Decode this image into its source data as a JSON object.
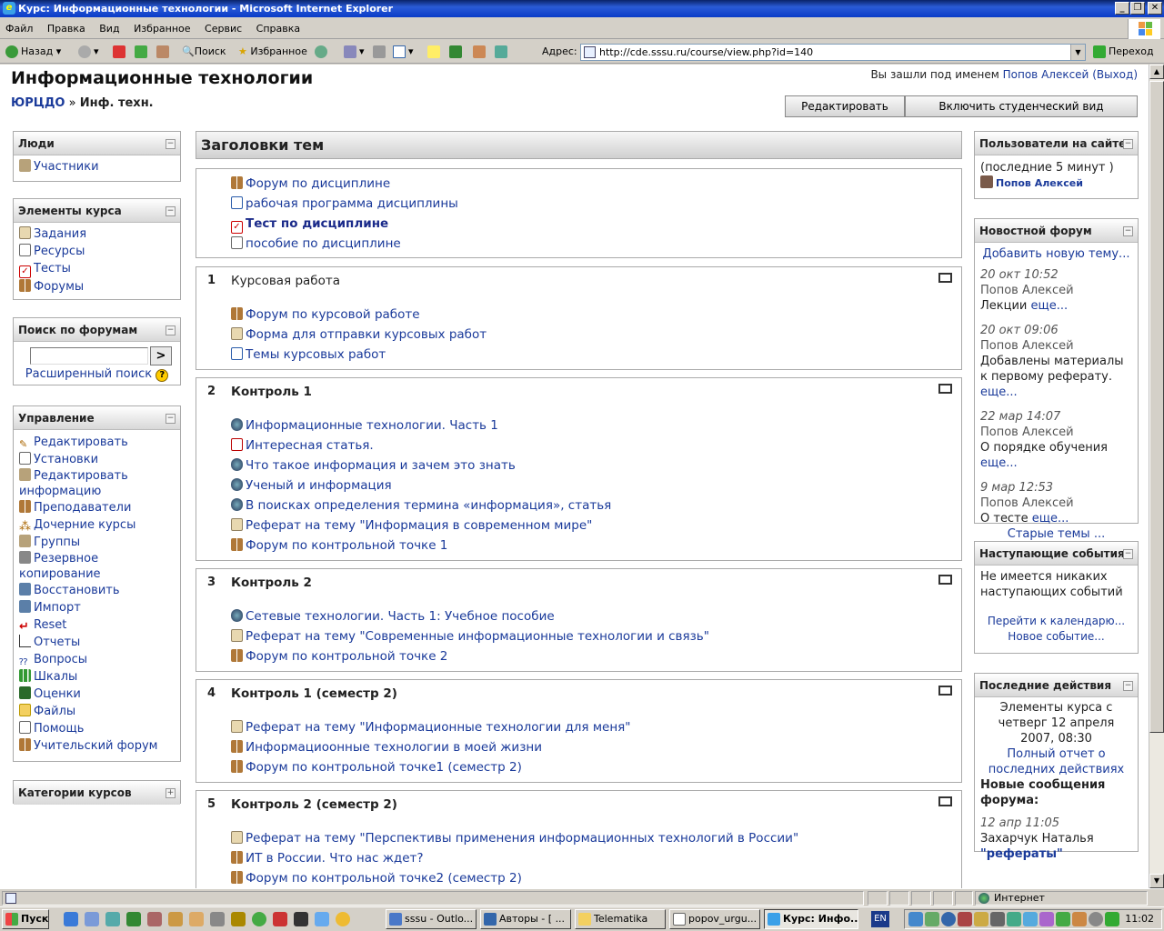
{
  "window": {
    "title": "Курс: Информационные технологии - Microsoft Internet Explorer"
  },
  "menu": [
    "Файл",
    "Правка",
    "Вид",
    "Избранное",
    "Сервис",
    "Справка"
  ],
  "toolbar": {
    "back": "Назад",
    "search": "Поиск",
    "favorites": "Избранное",
    "address_label": "Адрес:",
    "address": "http://cde.sssu.ru/course/view.php?id=140",
    "go": "Переход"
  },
  "header": {
    "title": "Информационные технологии",
    "login_prefix": "Вы зашли под именем",
    "login_user": "Попов Алексей",
    "logout": "(Выход)",
    "breadcrumb_root": "ЮРЦДО",
    "breadcrumb_sep": "»",
    "breadcrumb_current": "Инф. техн.",
    "edit_button": "Редактировать",
    "student_view_button": "Включить студенческий вид"
  },
  "left": {
    "people": {
      "title": "Люди",
      "items": [
        "Участники"
      ]
    },
    "elements": {
      "title": "Элементы курса",
      "items": [
        "Задания",
        "Ресурсы",
        "Тесты",
        "Форумы"
      ]
    },
    "forum_search": {
      "title": "Поиск по форумам",
      "go": ">",
      "advanced": "Расширенный поиск"
    },
    "admin": {
      "title": "Управление",
      "items": [
        "Редактировать",
        "Установки",
        "Редактировать информацию",
        "Преподаватели",
        "Дочерние курсы",
        "Группы",
        "Резервное копирование",
        "Восстановить",
        "Импорт",
        "Reset",
        "Отчеты",
        "Вопросы",
        "Шкалы",
        "Оценки",
        "Файлы",
        "Помощь",
        "Учительский форум"
      ]
    },
    "categories": {
      "title": "Категории курсов"
    }
  },
  "center": {
    "heading": "Заголовки тем",
    "section0": [
      "Форум по дисциплине",
      "рабочая программа дисциплины",
      "Тест по дисциплине",
      "пособие по дисциплине"
    ],
    "sections": [
      {
        "num": "1",
        "title": "Курсовая работа",
        "items": [
          "Форум по курсовой работе",
          "Форма для отправки курсовых работ",
          "Темы курсовых работ"
        ]
      },
      {
        "num": "2",
        "title": "Контроль 1",
        "items": [
          "Информационные технологии. Часть 1",
          "Интересная статья.",
          "Что такое информация и зачем это знать",
          "Ученый и информация",
          "В поисках определения термина «информация», статья",
          "Реферат на тему \"Информация в современном мире\"",
          "Форум по контрольной точке 1"
        ]
      },
      {
        "num": "3",
        "title": "Контроль 2",
        "items": [
          "Сетевые технологии. Часть 1: Учебное пособие",
          "Реферат на тему \"Современные информационные технологии и связь\"",
          "Форум по контрольной точке 2"
        ]
      },
      {
        "num": "4",
        "title": "Контроль 1 (семестр 2)",
        "items": [
          "Реферат на тему \"Информационные технологии для меня\"",
          "Информациоонные технологии в моей жизни",
          "Форум по контрольной точке1 (семестр 2)"
        ]
      },
      {
        "num": "5",
        "title": "Контроль 2 (семестр 2)",
        "items": [
          "Реферат на тему \"Перспективы применения информационных технологий в России\"",
          "ИТ в России. Что нас ждет?",
          "Форум по контрольной точке2 (семестр 2)"
        ]
      }
    ]
  },
  "right": {
    "online": {
      "title": "Пользователи на сайте",
      "period": "(последние 5 минут )",
      "user": "Попов Алексей"
    },
    "news": {
      "title": "Новостной форум",
      "add": "Добавить новую тему...",
      "posts": [
        {
          "date": "20 окт 10:52",
          "author": "Попов Алексей",
          "text": "Лекции",
          "more": "еще..."
        },
        {
          "date": "20 окт 09:06",
          "author": "Попов Алексей",
          "text": "Добавлены материалы к первому реферату.",
          "more": "еще..."
        },
        {
          "date": "22 мар 14:07",
          "author": "Попов Алексей",
          "text": "О порядке обучения",
          "more": "еще..."
        },
        {
          "date": "9 мар 12:53",
          "author": "Попов Алексей",
          "text": "О тесте",
          "more": "еще..."
        }
      ],
      "old": "Старые темы ..."
    },
    "events": {
      "title": "Наступающие события",
      "none": "Не имеется никаких наступающих событий",
      "calendar": "Перейти к календарю...",
      "new_event": "Новое событие..."
    },
    "recent": {
      "title": "Последние действия",
      "since": "Элементы курса с четверг 12 апреля 2007, 08:30",
      "full": "Полный отчет о последних действиях",
      "new_posts": "Новые сообщения форума:",
      "post_date": "12 апр 11:05",
      "post_author": "Захарчук Наталья",
      "post_subject": "\"рефераты\""
    }
  },
  "status": {
    "zone": "Интернет"
  },
  "taskbar": {
    "start": "Пуск",
    "tasks": [
      "sssu - Outlo...",
      "Авторы - [ ...",
      "Telematika",
      "popov_urgu...",
      "Курс: Инфо..."
    ],
    "active_index": 4,
    "lang": "EN",
    "clock": "11:02"
  }
}
